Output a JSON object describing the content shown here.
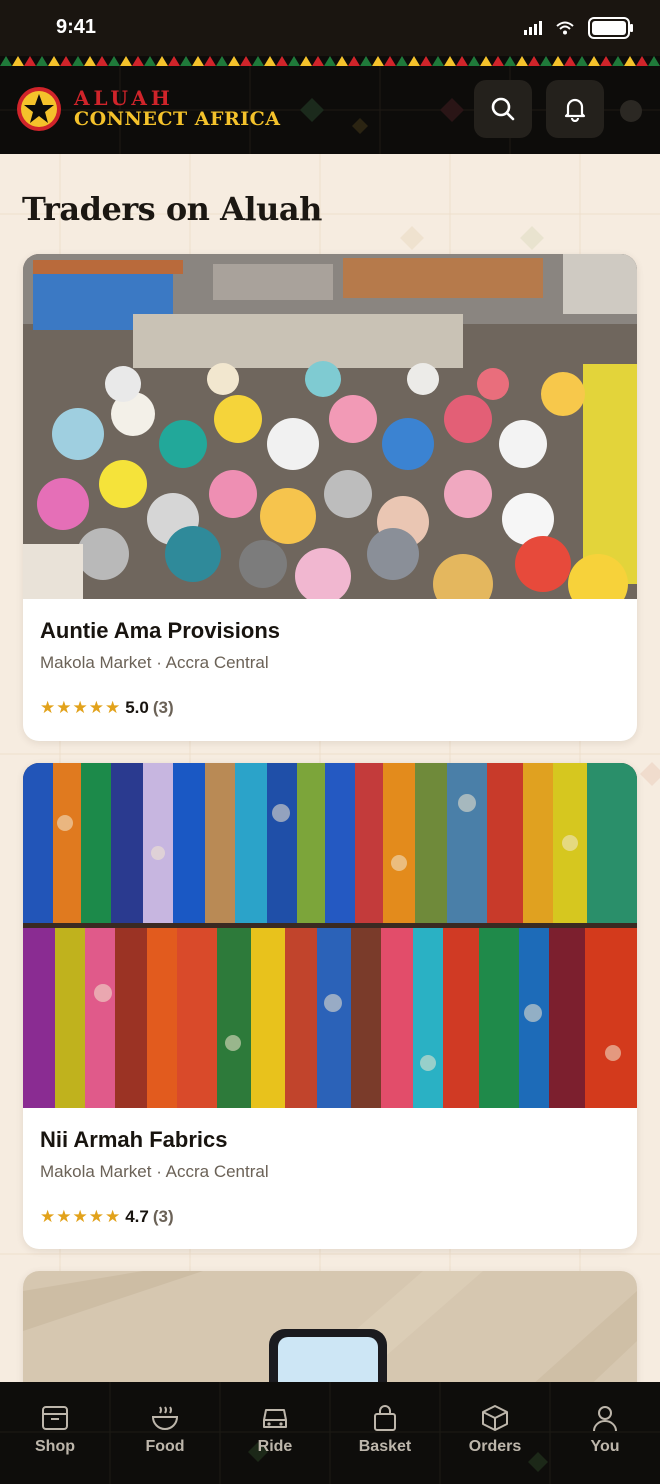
{
  "status_bar": {
    "time": "9:41"
  },
  "header": {
    "brand_top": "ALUAH",
    "brand_bottom": "CONNECT AFRICA",
    "search_icon": "search-icon",
    "bell_icon": "bell-icon"
  },
  "page": {
    "title": "Traders on Aluah"
  },
  "traders": [
    {
      "name": "Auntie Ama Provisions",
      "location": "Makola Market · Accra Central",
      "stars": "★★★★★",
      "rating": "5.0",
      "count": "(3)"
    },
    {
      "name": "Nii Armah Fabrics",
      "location": "Makola Market · Accra Central",
      "stars": "★★★★★",
      "rating": "4.7",
      "count": "(3)"
    }
  ],
  "nav": [
    {
      "label": "Shop",
      "icon": "shop-icon"
    },
    {
      "label": "Food",
      "icon": "bowl-icon"
    },
    {
      "label": "Ride",
      "icon": "car-icon"
    },
    {
      "label": "Basket",
      "icon": "basket-icon"
    },
    {
      "label": "Orders",
      "icon": "box-icon"
    },
    {
      "label": "You",
      "icon": "user-icon"
    }
  ],
  "colors": {
    "red": "#d0242a",
    "gold": "#f4c22b",
    "green": "#1f7a3a",
    "dark": "#0d0c0a",
    "cream": "#f6ece0",
    "star": "#e2a21b"
  }
}
